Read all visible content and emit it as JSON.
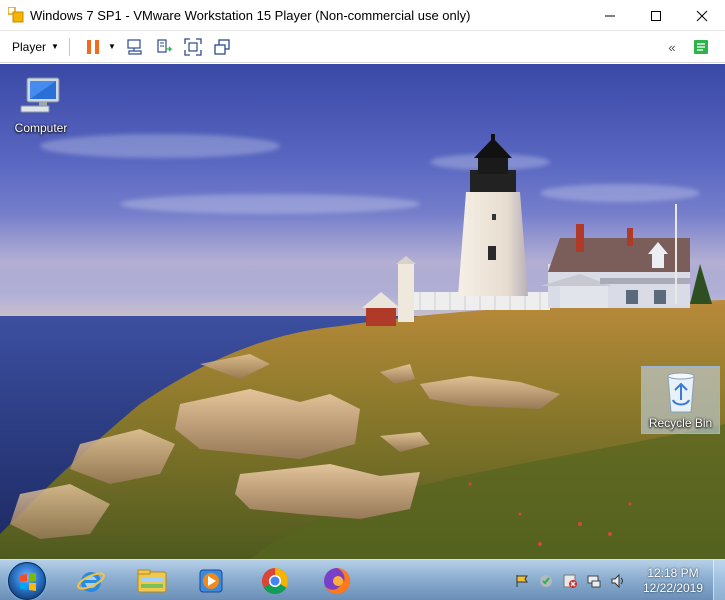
{
  "window": {
    "title": "Windows 7 SP1 - VMware Workstation 15 Player (Non-commercial use only)"
  },
  "toolbar": {
    "player_label": "Player"
  },
  "desktop": {
    "icons": [
      {
        "label": "Computer",
        "icon": "computer-icon"
      },
      {
        "label": "Recycle Bin",
        "icon": "recycle-bin-icon"
      }
    ]
  },
  "taskbar": {
    "pinned": [
      "internet-explorer-icon",
      "windows-explorer-icon",
      "media-player-icon",
      "chrome-icon",
      "firefox-icon"
    ],
    "clock_time": "12:18 PM",
    "clock_date": "12/22/2019"
  },
  "colors": {
    "pause_accent": "#f06a1f",
    "vmware_yellow": "#f4b400",
    "fullscreen_green": "#2db34a"
  }
}
